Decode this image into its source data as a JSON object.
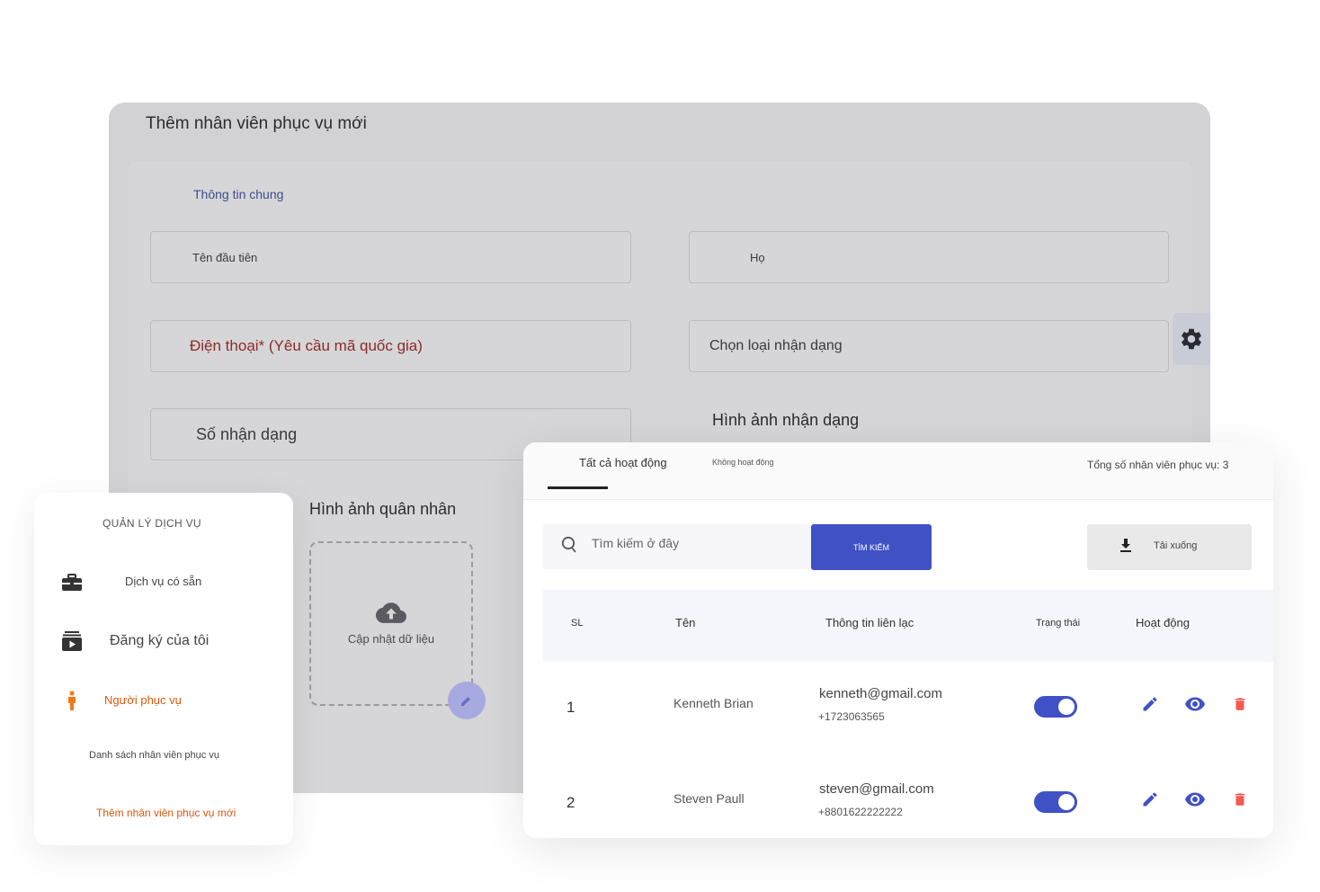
{
  "form": {
    "title": "Thêm nhân viên phục vụ mới",
    "section_label": "Thông tin chung",
    "first_name_placeholder": "Tên đầu tiên",
    "last_name_placeholder": "Họ",
    "phone_placeholder": "Điện thoại* (Yêu cầu mã quốc gia)",
    "id_type_placeholder": "Chọn loại nhận dạng",
    "id_number_placeholder": "Số nhận dạng",
    "id_image_title": "Hình ảnh nhận dạng",
    "soldier_image_title": "Hình ảnh quân nhân",
    "upload_label": "Cập nhật dữ liệu"
  },
  "sidebar": {
    "heading": "QUẢN LÝ DỊCH VỤ",
    "items": [
      {
        "label": "Dịch vụ có sẵn",
        "icon": "briefcase-icon"
      },
      {
        "label": "Đăng ký của tôi",
        "icon": "subscription-icon"
      },
      {
        "label": "Người phục vụ",
        "icon": "person-icon",
        "active": true
      }
    ],
    "sub_items": [
      {
        "label": "Danh sách nhân viên phục vụ"
      },
      {
        "label": "Thêm nhân viên phục vụ mới",
        "active": true
      }
    ]
  },
  "table_card": {
    "tabs": [
      {
        "label": "Tất cả hoạt động",
        "active": true
      },
      {
        "label": "Không hoạt động",
        "active": false
      }
    ],
    "total_count": "Tổng số nhân viên phục vụ: 3",
    "search_placeholder": "Tìm kiếm ở đây",
    "search_button": "TÌM KIẾM",
    "download_button": "Tải xuống",
    "columns": [
      "SL",
      "Tên",
      "Thông tin liên lạc",
      "Trạng thái",
      "Hoạt động"
    ],
    "rows": [
      {
        "sl": "1",
        "name": "Kenneth Brian",
        "email": "kenneth@gmail.com",
        "phone": "+1723063565",
        "active": true
      },
      {
        "sl": "2",
        "name": "Steven Paull",
        "email": "steven@gmail.com",
        "phone": "+8801622222222",
        "active": true
      }
    ]
  },
  "colors": {
    "accent": "#3f51c5",
    "active_nav": "#d9580d",
    "delete": "#f25a50",
    "panel_bg": "#d2d2d4"
  }
}
